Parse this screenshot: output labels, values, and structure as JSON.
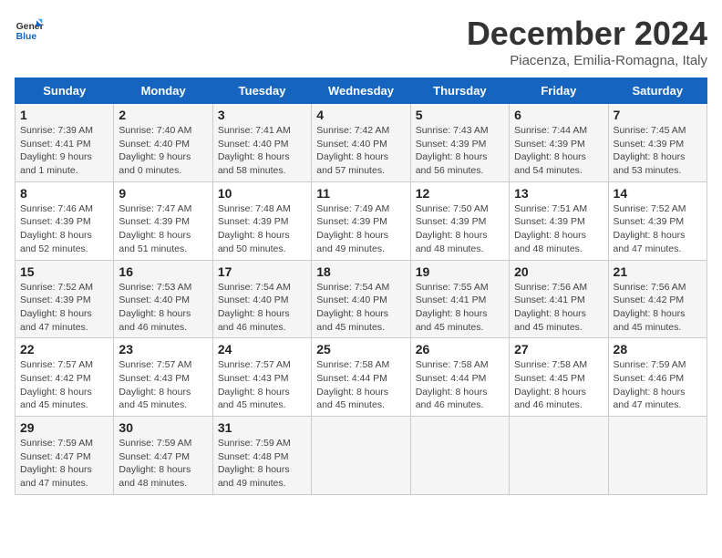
{
  "logo": {
    "line1": "General",
    "line2": "Blue"
  },
  "title": "December 2024",
  "location": "Piacenza, Emilia-Romagna, Italy",
  "days_of_week": [
    "Sunday",
    "Monday",
    "Tuesday",
    "Wednesday",
    "Thursday",
    "Friday",
    "Saturday"
  ],
  "weeks": [
    [
      {
        "day": 1,
        "detail": "Sunrise: 7:39 AM\nSunset: 4:41 PM\nDaylight: 9 hours\nand 1 minute."
      },
      {
        "day": 2,
        "detail": "Sunrise: 7:40 AM\nSunset: 4:40 PM\nDaylight: 9 hours\nand 0 minutes."
      },
      {
        "day": 3,
        "detail": "Sunrise: 7:41 AM\nSunset: 4:40 PM\nDaylight: 8 hours\nand 58 minutes."
      },
      {
        "day": 4,
        "detail": "Sunrise: 7:42 AM\nSunset: 4:40 PM\nDaylight: 8 hours\nand 57 minutes."
      },
      {
        "day": 5,
        "detail": "Sunrise: 7:43 AM\nSunset: 4:39 PM\nDaylight: 8 hours\nand 56 minutes."
      },
      {
        "day": 6,
        "detail": "Sunrise: 7:44 AM\nSunset: 4:39 PM\nDaylight: 8 hours\nand 54 minutes."
      },
      {
        "day": 7,
        "detail": "Sunrise: 7:45 AM\nSunset: 4:39 PM\nDaylight: 8 hours\nand 53 minutes."
      }
    ],
    [
      {
        "day": 8,
        "detail": "Sunrise: 7:46 AM\nSunset: 4:39 PM\nDaylight: 8 hours\nand 52 minutes."
      },
      {
        "day": 9,
        "detail": "Sunrise: 7:47 AM\nSunset: 4:39 PM\nDaylight: 8 hours\nand 51 minutes."
      },
      {
        "day": 10,
        "detail": "Sunrise: 7:48 AM\nSunset: 4:39 PM\nDaylight: 8 hours\nand 50 minutes."
      },
      {
        "day": 11,
        "detail": "Sunrise: 7:49 AM\nSunset: 4:39 PM\nDaylight: 8 hours\nand 49 minutes."
      },
      {
        "day": 12,
        "detail": "Sunrise: 7:50 AM\nSunset: 4:39 PM\nDaylight: 8 hours\nand 48 minutes."
      },
      {
        "day": 13,
        "detail": "Sunrise: 7:51 AM\nSunset: 4:39 PM\nDaylight: 8 hours\nand 48 minutes."
      },
      {
        "day": 14,
        "detail": "Sunrise: 7:52 AM\nSunset: 4:39 PM\nDaylight: 8 hours\nand 47 minutes."
      }
    ],
    [
      {
        "day": 15,
        "detail": "Sunrise: 7:52 AM\nSunset: 4:39 PM\nDaylight: 8 hours\nand 47 minutes."
      },
      {
        "day": 16,
        "detail": "Sunrise: 7:53 AM\nSunset: 4:40 PM\nDaylight: 8 hours\nand 46 minutes."
      },
      {
        "day": 17,
        "detail": "Sunrise: 7:54 AM\nSunset: 4:40 PM\nDaylight: 8 hours\nand 46 minutes."
      },
      {
        "day": 18,
        "detail": "Sunrise: 7:54 AM\nSunset: 4:40 PM\nDaylight: 8 hours\nand 45 minutes."
      },
      {
        "day": 19,
        "detail": "Sunrise: 7:55 AM\nSunset: 4:41 PM\nDaylight: 8 hours\nand 45 minutes."
      },
      {
        "day": 20,
        "detail": "Sunrise: 7:56 AM\nSunset: 4:41 PM\nDaylight: 8 hours\nand 45 minutes."
      },
      {
        "day": 21,
        "detail": "Sunrise: 7:56 AM\nSunset: 4:42 PM\nDaylight: 8 hours\nand 45 minutes."
      }
    ],
    [
      {
        "day": 22,
        "detail": "Sunrise: 7:57 AM\nSunset: 4:42 PM\nDaylight: 8 hours\nand 45 minutes."
      },
      {
        "day": 23,
        "detail": "Sunrise: 7:57 AM\nSunset: 4:43 PM\nDaylight: 8 hours\nand 45 minutes."
      },
      {
        "day": 24,
        "detail": "Sunrise: 7:57 AM\nSunset: 4:43 PM\nDaylight: 8 hours\nand 45 minutes."
      },
      {
        "day": 25,
        "detail": "Sunrise: 7:58 AM\nSunset: 4:44 PM\nDaylight: 8 hours\nand 45 minutes."
      },
      {
        "day": 26,
        "detail": "Sunrise: 7:58 AM\nSunset: 4:44 PM\nDaylight: 8 hours\nand 46 minutes."
      },
      {
        "day": 27,
        "detail": "Sunrise: 7:58 AM\nSunset: 4:45 PM\nDaylight: 8 hours\nand 46 minutes."
      },
      {
        "day": 28,
        "detail": "Sunrise: 7:59 AM\nSunset: 4:46 PM\nDaylight: 8 hours\nand 47 minutes."
      }
    ],
    [
      {
        "day": 29,
        "detail": "Sunrise: 7:59 AM\nSunset: 4:47 PM\nDaylight: 8 hours\nand 47 minutes."
      },
      {
        "day": 30,
        "detail": "Sunrise: 7:59 AM\nSunset: 4:47 PM\nDaylight: 8 hours\nand 48 minutes."
      },
      {
        "day": 31,
        "detail": "Sunrise: 7:59 AM\nSunset: 4:48 PM\nDaylight: 8 hours\nand 49 minutes."
      },
      null,
      null,
      null,
      null
    ]
  ]
}
